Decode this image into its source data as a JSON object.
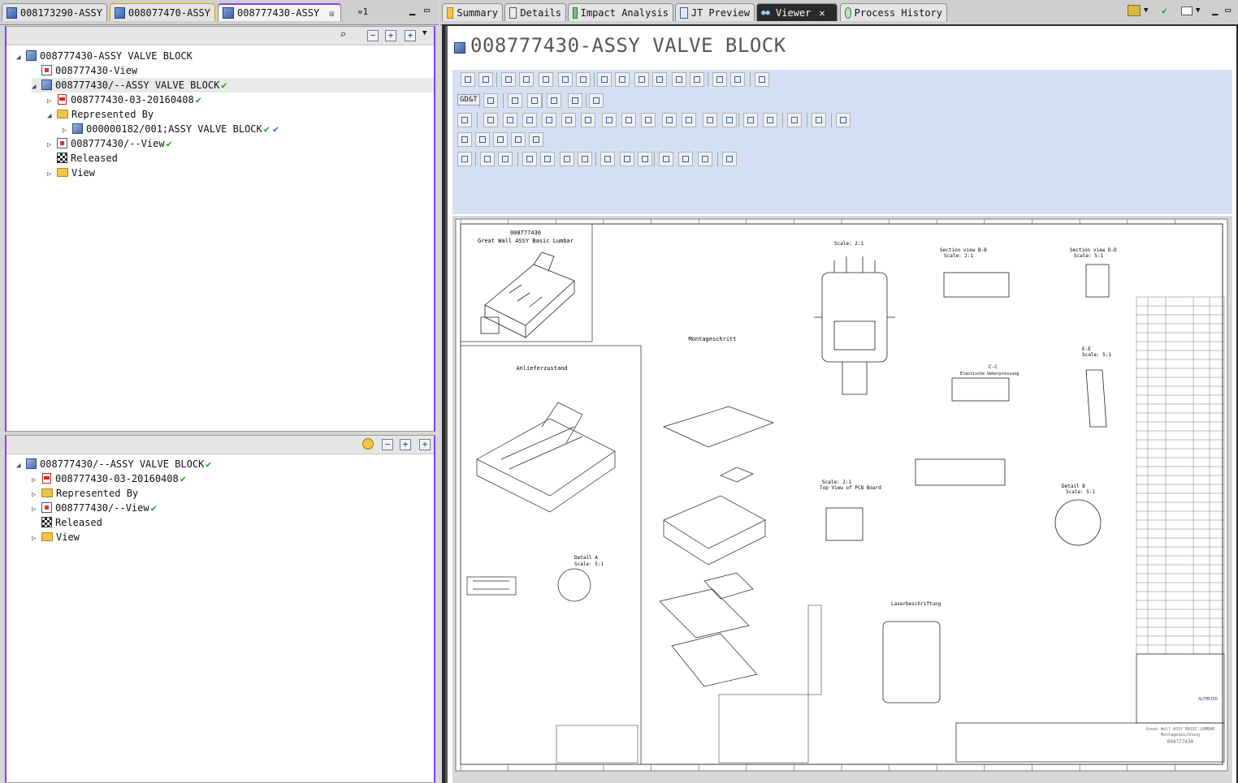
{
  "left_tabs": [
    {
      "label": "008173290-ASSY"
    },
    {
      "label": "008077470-ASSY"
    },
    {
      "label": "008777430-ASSY"
    }
  ],
  "left_overflow": "»1",
  "right_tabs": [
    {
      "label": "Summary"
    },
    {
      "label": "Details"
    },
    {
      "label": "Impact Analysis"
    },
    {
      "label": "JT Preview"
    },
    {
      "label": "Viewer"
    },
    {
      "label": "Process History"
    }
  ],
  "tree_top": [
    {
      "label": "008777430-ASSY VALVE BLOCK",
      "indent": 0,
      "icon": "item-icon",
      "twisty": "open",
      "check": ""
    },
    {
      "label": "008777430-View",
      "indent": 1,
      "icon": "view-icon",
      "twisty": "",
      "check": ""
    },
    {
      "label": "008777430/--ASSY VALVE BLOCK",
      "indent": 1,
      "icon": "item-icon",
      "twisty": "open",
      "check": "✔"
    },
    {
      "label": "008777430-03-20160408",
      "indent": 2,
      "icon": "pdf-icon",
      "twisty": "closed",
      "check": "✔"
    },
    {
      "label": "Represented By",
      "indent": 2,
      "icon": "folder-icon",
      "twisty": "open",
      "check": ""
    },
    {
      "label": "000000182/001;ASSY VALVE BLOCK",
      "indent": 3,
      "icon": "item-icon",
      "twisty": "closed",
      "check": "✔"
    },
    {
      "label": "008777430/--View",
      "indent": 2,
      "icon": "view-icon",
      "twisty": "closed",
      "check": "✔"
    },
    {
      "label": "Released",
      "indent": 2,
      "icon": "flag-icon",
      "twisty": "",
      "check": ""
    },
    {
      "label": "View",
      "indent": 2,
      "icon": "folder-icon",
      "twisty": "closed",
      "check": ""
    }
  ],
  "tree_bottom": [
    {
      "label": "008777430/--ASSY VALVE BLOCK",
      "indent": 0,
      "icon": "item-icon",
      "twisty": "open",
      "check": "✔"
    },
    {
      "label": "008777430-03-20160408",
      "indent": 1,
      "icon": "pdf-icon",
      "twisty": "closed",
      "check": "✔"
    },
    {
      "label": "Represented By",
      "indent": 1,
      "icon": "folder-icon",
      "twisty": "closed",
      "check": ""
    },
    {
      "label": "008777430/--View",
      "indent": 1,
      "icon": "view-icon",
      "twisty": "closed",
      "check": "✔"
    },
    {
      "label": "Released",
      "indent": 1,
      "icon": "flag-icon",
      "twisty": "",
      "check": ""
    },
    {
      "label": "View",
      "indent": 1,
      "icon": "folder-icon",
      "twisty": "closed",
      "check": ""
    }
  ],
  "viewer": {
    "title": "008777430-ASSY VALVE BLOCK",
    "gdt_label": "GD&T"
  },
  "drawing": {
    "part_no": "008777430",
    "part_name": "Great Wall ASSY Basic Lumbar",
    "scale_main": "Scale:  2:1",
    "section_bb": "Section view B-B",
    "section_bb_scale": "Scale:  2:1",
    "section_dd": "Section view D-D",
    "section_dd_scale": "Scale:  5:1",
    "section_ee": "E-E",
    "section_ee_scale": "Scale:  5:1",
    "section_cc": "C-C",
    "cc_note": "Elastische Ueberpressung",
    "montage_title": "Montageschritt",
    "anlieferzustand": "Anlieferzustand",
    "pcb_scale": "Scale:  2:1",
    "pcb_label": "Top View of PCB Board",
    "detail_a": "Detail A",
    "detail_a_scale": "Scale:  5:1",
    "detail_b": "Detail B",
    "detail_b_scale": "Scale:  5:1",
    "laser": "Laserbeschriftung",
    "title_block_name": "Great Wall ASSY BASIC LUMBAR",
    "title_block_sub": "Montagezeichnung",
    "title_block_no": "008777430",
    "company": "ALFMEIER"
  }
}
